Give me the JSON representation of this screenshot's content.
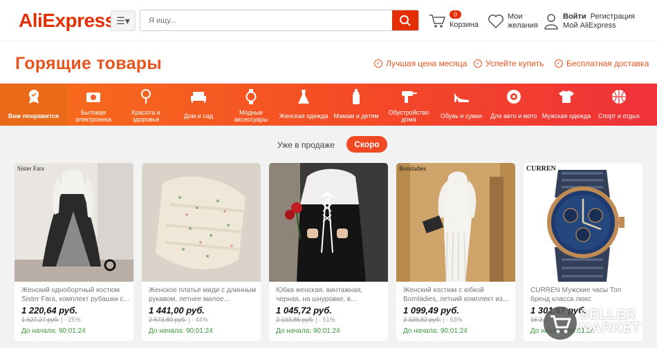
{
  "header": {
    "logo": "AliExpress",
    "search_placeholder": "Я ищу...",
    "cart_count": "0",
    "cart_label": "Корзина",
    "wishlist_label_1": "Мои",
    "wishlist_label_2": "желания",
    "login_label": "Войти",
    "register_label": "Регистрация",
    "my_account_label": "Мой AliExpress"
  },
  "page": {
    "title": "Горящие товары",
    "features": [
      "Лучшая цена месяца",
      "Успейте купить",
      "Бесплатная доставка"
    ]
  },
  "categories": [
    {
      "label": "Вам понравится",
      "icon": "badge-icon"
    },
    {
      "label": "Бытовая электроника",
      "icon": "camera-icon"
    },
    {
      "label": "Красота и здоровье",
      "icon": "mirror-icon"
    },
    {
      "label": "Дом и сад",
      "icon": "sofa-icon"
    },
    {
      "label": "Модные аксессуары",
      "icon": "watch-icon"
    },
    {
      "label": "Женская одежда",
      "icon": "dress-icon"
    },
    {
      "label": "Мамам и детям",
      "icon": "bottle-icon"
    },
    {
      "label": "Обустройство дома",
      "icon": "drill-icon"
    },
    {
      "label": "Обувь и сумки",
      "icon": "heel-icon"
    },
    {
      "label": "Для авто и мото",
      "icon": "wheel-icon"
    },
    {
      "label": "Мужская одежда",
      "icon": "tshirt-icon"
    },
    {
      "label": "Спорт и отдых",
      "icon": "ball-icon"
    }
  ],
  "tabs": {
    "on_sale": "Уже в продаже",
    "soon": "Скоро"
  },
  "products": [
    {
      "brand": "Sister Fara",
      "name": "Женский однобортный костюм Sister Fara, комплект рубашки с...",
      "price": "1 220,64 руб.",
      "old_price": "1 627,27 руб.",
      "discount": "| - 25%",
      "start": "До начала: 90:01:24"
    },
    {
      "brand": "",
      "name": "Женское платье миди с длинным рукавом, летнее милое...",
      "price": "1 441,00 руб.",
      "old_price": "2 573,80 руб.",
      "discount": "| - 44%",
      "start": "До начала: 90:01:24"
    },
    {
      "brand": "",
      "name": "Юбка женская, винтажная, черная, на шнуровке, в...",
      "price": "1 045,72 руб.",
      "old_price": "2 133,85 руб.",
      "discount": "| - 51%",
      "start": "До начала: 90:01:24"
    },
    {
      "brand": "Bornladies",
      "name": "Женский костюм с юбкой Bornladies, летний комплект из...",
      "price": "1 099,49 руб.",
      "old_price": "2 339,82 руб.",
      "discount": "| - 53%",
      "start": "До начала: 90:01:24"
    },
    {
      "brand": "CURREN",
      "name": "CURREN Мужские часы Топ бренд класса люкс Спортивные...",
      "price": "1 301,67 руб.",
      "old_price": "16 2...",
      "discount": "",
      "start": "До начала: 90:01:24"
    }
  ],
  "watermark": {
    "line1": "SELLER",
    "line2": "MARKET"
  },
  "colors": {
    "accent": "#e62e04",
    "title_orange": "#e8541e",
    "green": "#3a9a3a"
  }
}
